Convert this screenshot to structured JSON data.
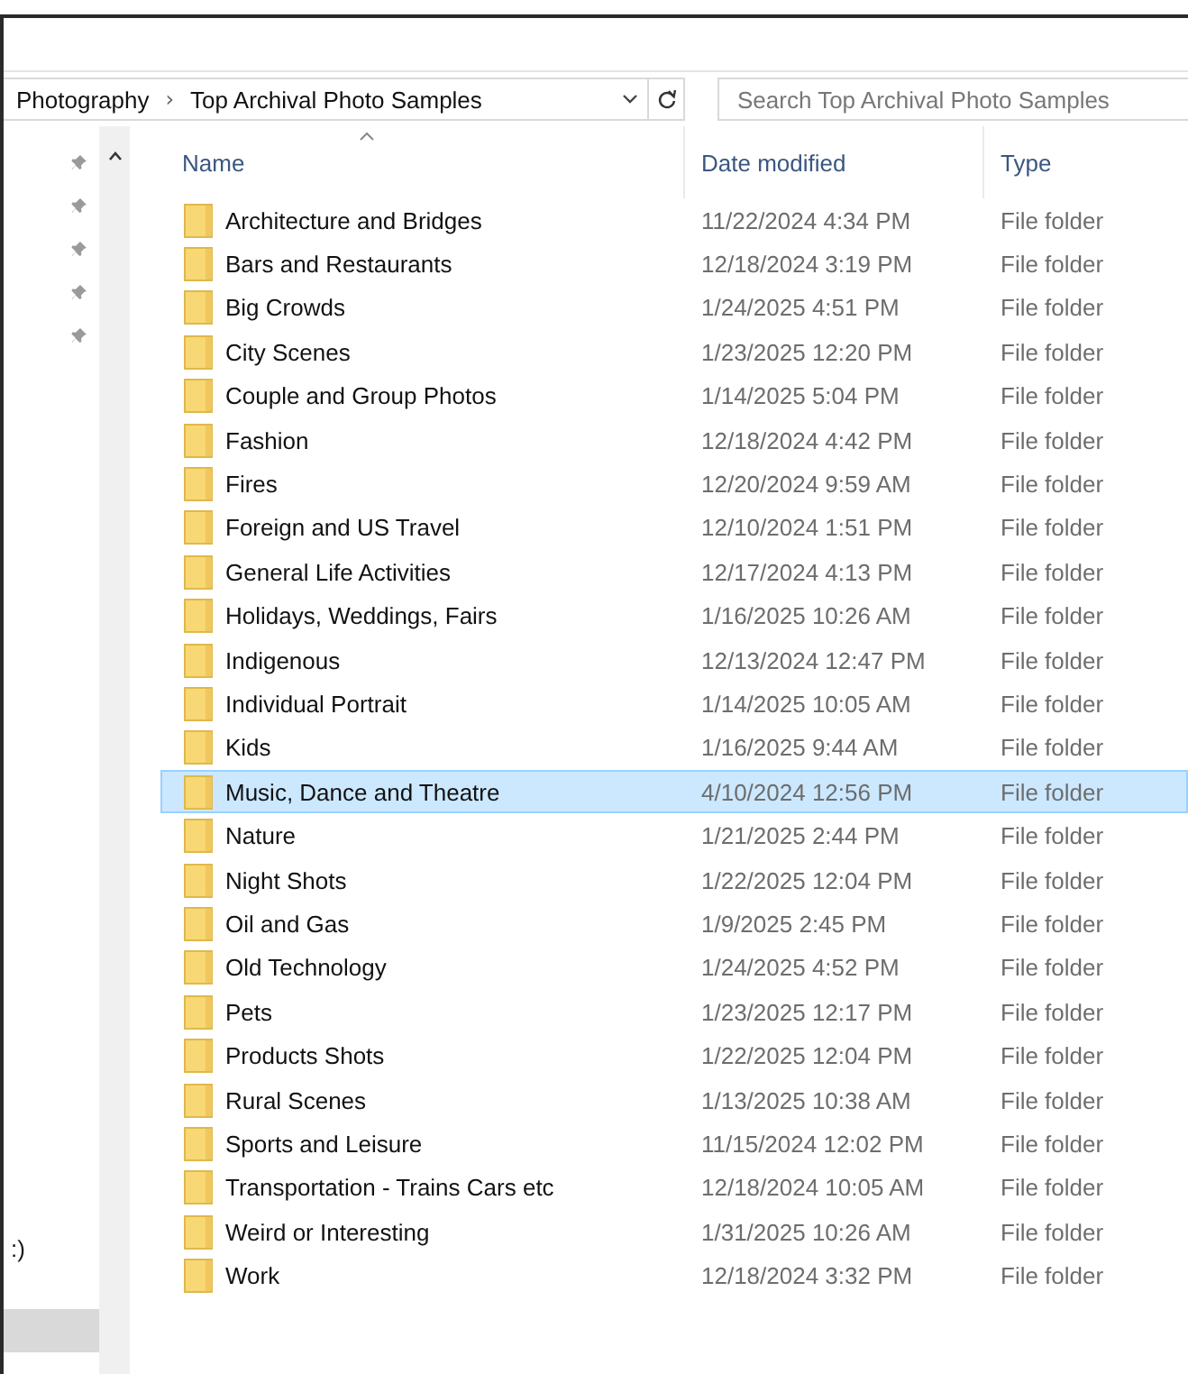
{
  "address_bar": {
    "breadcrumbs": [
      {
        "label": "Photography"
      },
      {
        "label": "Top Archival Photo Samples"
      }
    ],
    "separator": "›"
  },
  "search": {
    "placeholder": "Search Top Archival Photo Samples"
  },
  "navigation": {
    "pins": [
      {
        "pinned": true
      },
      {
        "pinned": true
      },
      {
        "pinned": true
      },
      {
        "pinned": true
      },
      {
        "pinned": true
      }
    ],
    "partial_label": ":)",
    "items": [
      {
        "selected": true
      }
    ]
  },
  "columns": [
    {
      "label": "Name",
      "sorted": true
    },
    {
      "label": "Date modified",
      "sorted": false
    },
    {
      "label": "Type",
      "sorted": false
    }
  ],
  "rows": [
    {
      "name": "Architecture and Bridges",
      "date": "11/22/2024 4:34 PM",
      "type": "File folder",
      "selected": false
    },
    {
      "name": "Bars and Restaurants",
      "date": "12/18/2024 3:19 PM",
      "type": "File folder",
      "selected": false
    },
    {
      "name": "Big Crowds",
      "date": "1/24/2025 4:51 PM",
      "type": "File folder",
      "selected": false
    },
    {
      "name": "City Scenes",
      "date": "1/23/2025 12:20 PM",
      "type": "File folder",
      "selected": false
    },
    {
      "name": "Couple and Group Photos",
      "date": "1/14/2025 5:04 PM",
      "type": "File folder",
      "selected": false
    },
    {
      "name": "Fashion",
      "date": "12/18/2024 4:42 PM",
      "type": "File folder",
      "selected": false
    },
    {
      "name": "Fires",
      "date": "12/20/2024 9:59 AM",
      "type": "File folder",
      "selected": false
    },
    {
      "name": "Foreign and US Travel",
      "date": "12/10/2024 1:51 PM",
      "type": "File folder",
      "selected": false
    },
    {
      "name": "General Life Activities",
      "date": "12/17/2024 4:13 PM",
      "type": "File folder",
      "selected": false
    },
    {
      "name": "Holidays, Weddings, Fairs",
      "date": "1/16/2025 10:26 AM",
      "type": "File folder",
      "selected": false
    },
    {
      "name": "Indigenous",
      "date": "12/13/2024 12:47 PM",
      "type": "File folder",
      "selected": false
    },
    {
      "name": "Individual Portrait",
      "date": "1/14/2025 10:05 AM",
      "type": "File folder",
      "selected": false
    },
    {
      "name": "Kids",
      "date": "1/16/2025 9:44 AM",
      "type": "File folder",
      "selected": false
    },
    {
      "name": "Music, Dance and Theatre",
      "date": "4/10/2024 12:56 PM",
      "type": "File folder",
      "selected": true
    },
    {
      "name": "Nature",
      "date": "1/21/2025 2:44 PM",
      "type": "File folder",
      "selected": false
    },
    {
      "name": "Night Shots",
      "date": "1/22/2025 12:04 PM",
      "type": "File folder",
      "selected": false
    },
    {
      "name": "Oil and Gas",
      "date": "1/9/2025 2:45 PM",
      "type": "File folder",
      "selected": false
    },
    {
      "name": "Old Technology",
      "date": "1/24/2025 4:52 PM",
      "type": "File folder",
      "selected": false
    },
    {
      "name": "Pets",
      "date": "1/23/2025 12:17 PM",
      "type": "File folder",
      "selected": false
    },
    {
      "name": "Products Shots",
      "date": "1/22/2025 12:04 PM",
      "type": "File folder",
      "selected": false
    },
    {
      "name": "Rural Scenes",
      "date": "1/13/2025 10:38 AM",
      "type": "File folder",
      "selected": false
    },
    {
      "name": "Sports and Leisure",
      "date": "11/15/2024 12:02 PM",
      "type": "File folder",
      "selected": false
    },
    {
      "name": "Transportation - Trains Cars etc",
      "date": "12/18/2024 10:05 AM",
      "type": "File folder",
      "selected": false
    },
    {
      "name": "Weird or Interesting",
      "date": "1/31/2025 10:26 AM",
      "type": "File folder",
      "selected": false
    },
    {
      "name": "Work",
      "date": "12/18/2024 3:32 PM",
      "type": "File folder",
      "selected": false
    }
  ]
}
